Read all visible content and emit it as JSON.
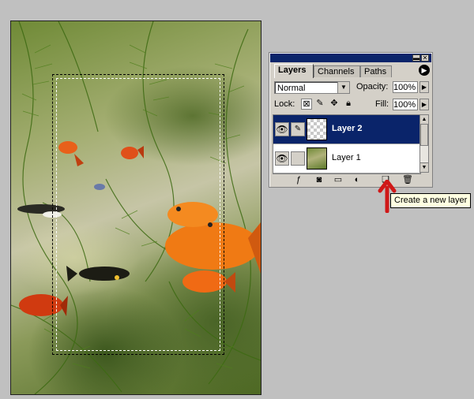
{
  "canvas": {
    "image_description_name": "aquarium-photo"
  },
  "palette": {
    "tabs": [
      {
        "label": "Layers",
        "active": true
      },
      {
        "label": "Channels",
        "active": false
      },
      {
        "label": "Paths",
        "active": false
      }
    ],
    "blend_mode": "Normal",
    "opacity_label": "Opacity:",
    "opacity_value": "100%",
    "lock_label": "Lock:",
    "fill_label": "Fill:",
    "fill_value": "100%",
    "layers": [
      {
        "name": "Layer 2",
        "selected": true
      },
      {
        "name": "Layer 1",
        "selected": false
      }
    ],
    "colors": {
      "titlebar": "#0a246a",
      "selection": "#0a246a"
    }
  },
  "tooltip": {
    "text": "Create a new layer"
  },
  "icons": {
    "eye": "eye-icon",
    "brush": "brush-icon",
    "add_style": "layer-style-icon",
    "mask": "layer-mask-icon",
    "group": "new-group-icon",
    "adjustment": "adjustment-layer-icon",
    "new_layer": "new-layer-icon",
    "trash": "trash-icon",
    "annotation_arrow": "red-arrow-icon"
  }
}
